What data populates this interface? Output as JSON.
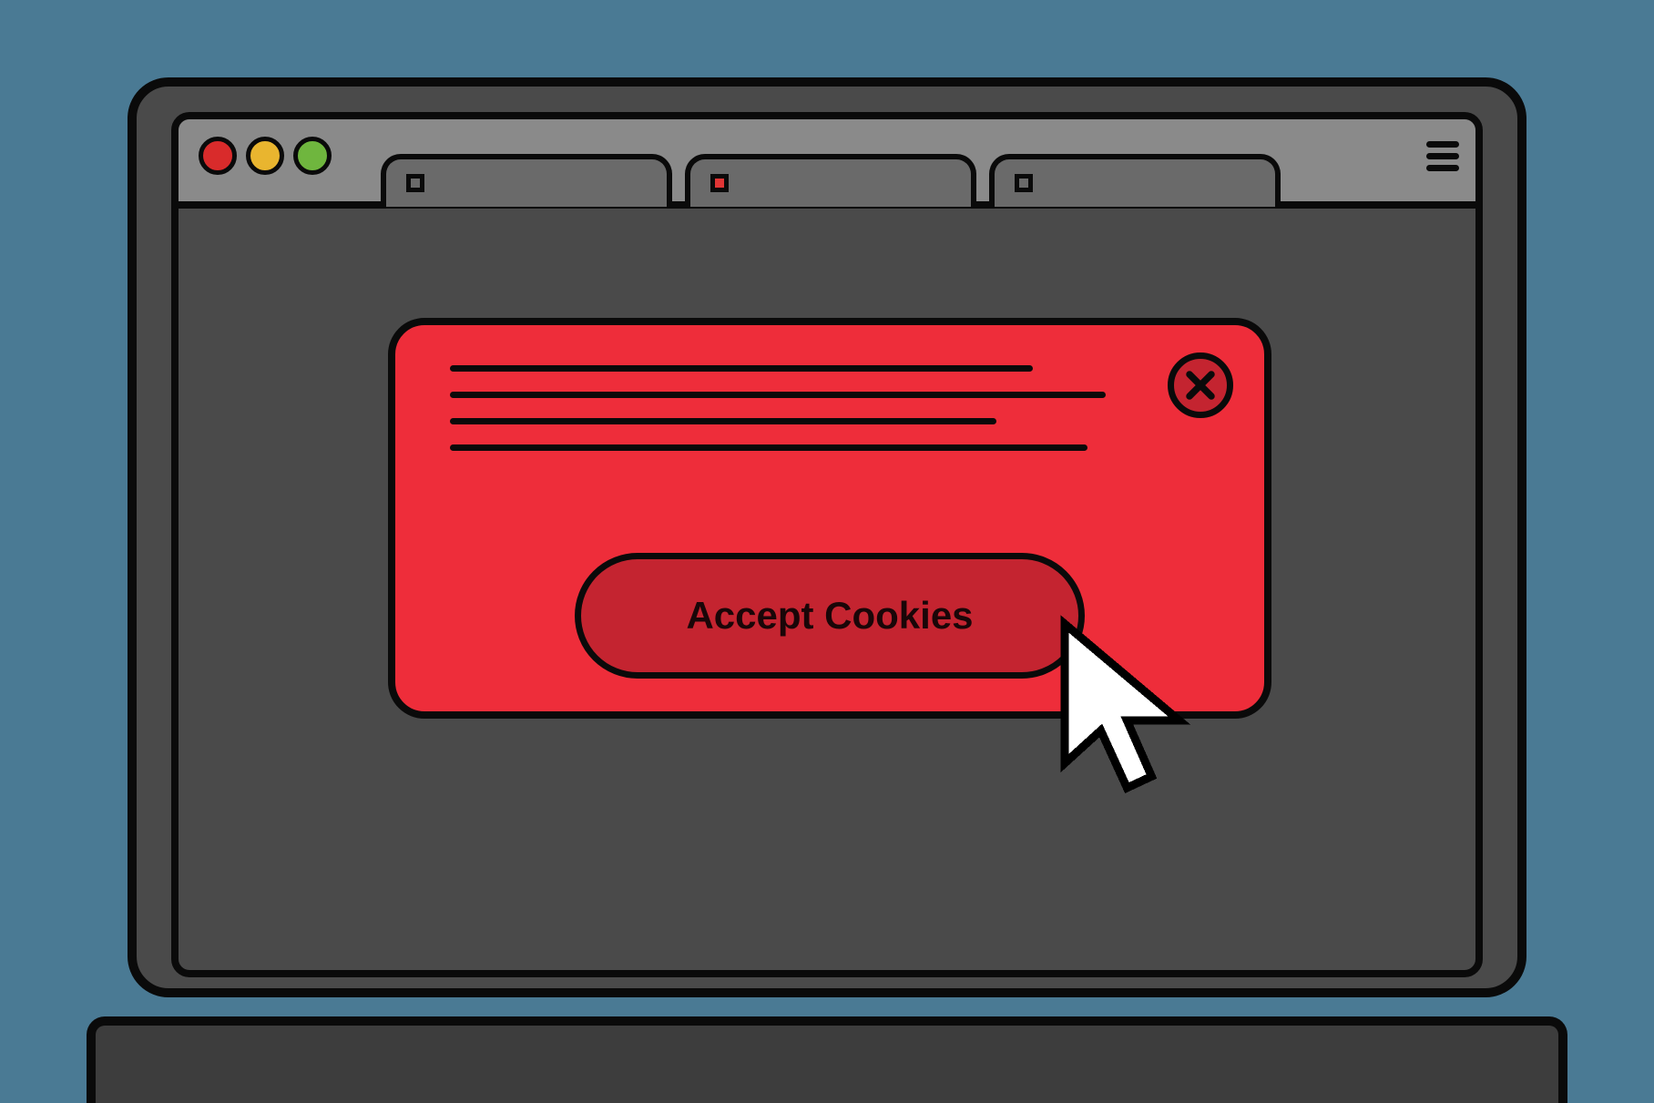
{
  "window": {
    "traffic_lights": [
      "close",
      "minimize",
      "zoom"
    ]
  },
  "tabs": [
    {
      "id": "tab-1",
      "active": false
    },
    {
      "id": "tab-2",
      "active": true
    },
    {
      "id": "tab-3",
      "active": false
    }
  ],
  "dialog": {
    "accept_label": "Accept Cookies",
    "close_label": "Close"
  },
  "colors": {
    "background": "#4a7a94",
    "dialog_bg": "#ee2d3a",
    "dialog_button": "#c42430",
    "chrome_light": "#8a8a8a",
    "chrome_dark": "#4a4a4a",
    "stroke": "#0a0a0a"
  }
}
